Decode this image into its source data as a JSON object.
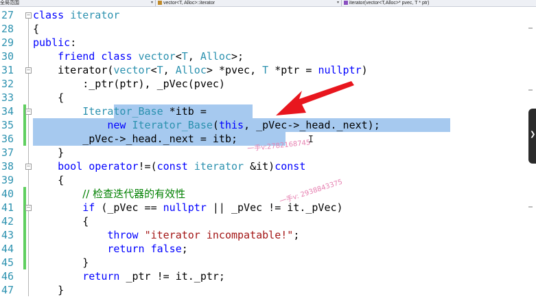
{
  "navbar": {
    "project_scope": "全局范围",
    "class_scope": "vector<T, Alloc>::iterator",
    "member_scope": "iterator(vector<T,Alloc>* pvec, T * ptr)"
  },
  "editor": {
    "lines": [
      {
        "n": "27",
        "tokens": [
          [
            "kw",
            "class "
          ],
          [
            "ty",
            "iterator"
          ]
        ]
      },
      {
        "n": "28",
        "tokens": [
          [
            "p",
            "{"
          ]
        ]
      },
      {
        "n": "29",
        "tokens": [
          [
            "kw",
            "public"
          ],
          [
            "p",
            ":"
          ]
        ]
      },
      {
        "n": "30",
        "tokens": [
          [
            "p",
            "    "
          ],
          [
            "kw",
            "friend class "
          ],
          [
            "ty",
            "vector"
          ],
          [
            "p",
            "<"
          ],
          [
            "ty",
            "T"
          ],
          [
            "p",
            ", "
          ],
          [
            "ty",
            "Alloc"
          ],
          [
            "p",
            ">;"
          ]
        ]
      },
      {
        "n": "31",
        "tokens": [
          [
            "p",
            "    iterator("
          ],
          [
            "ty",
            "vector"
          ],
          [
            "p",
            "<"
          ],
          [
            "ty",
            "T"
          ],
          [
            "p",
            ", "
          ],
          [
            "ty",
            "Alloc"
          ],
          [
            "p",
            "> *pvec, "
          ],
          [
            "ty",
            "T"
          ],
          [
            "p",
            " *ptr = "
          ],
          [
            "kw",
            "nullptr"
          ],
          [
            "p",
            ")"
          ]
        ]
      },
      {
        "n": "32",
        "tokens": [
          [
            "p",
            "        :_ptr(ptr), _pVec(pvec)"
          ]
        ]
      },
      {
        "n": "33",
        "tokens": [
          [
            "p",
            "    {"
          ]
        ]
      },
      {
        "n": "34",
        "tokens": [
          [
            "p",
            "        "
          ],
          [
            "ty",
            "Iterator_Base"
          ],
          [
            "p",
            " *itb ="
          ]
        ]
      },
      {
        "n": "35",
        "tokens": [
          [
            "p",
            "            "
          ],
          [
            "kw",
            "new "
          ],
          [
            "ty",
            "Iterator_Base"
          ],
          [
            "p",
            "("
          ],
          [
            "kw",
            "this"
          ],
          [
            "p",
            ", _pVec->_head._next);"
          ]
        ]
      },
      {
        "n": "36",
        "tokens": [
          [
            "p",
            "        _pVec->_head._next = itb;"
          ]
        ]
      },
      {
        "n": "37",
        "tokens": [
          [
            "p",
            "    }"
          ]
        ]
      },
      {
        "n": "38",
        "tokens": [
          [
            "p",
            "    "
          ],
          [
            "kw",
            "bool "
          ],
          [
            "kw",
            "operator"
          ],
          [
            "p",
            "!=("
          ],
          [
            "kw",
            "const "
          ],
          [
            "ty",
            "iterator"
          ],
          [
            "p",
            " &it)"
          ],
          [
            "kw",
            "const"
          ]
        ]
      },
      {
        "n": "39",
        "tokens": [
          [
            "p",
            "    {"
          ]
        ]
      },
      {
        "n": "40",
        "tokens": [
          [
            "p",
            "        "
          ],
          [
            "cm",
            "// 检查迭代器的有效性"
          ]
        ]
      },
      {
        "n": "41",
        "tokens": [
          [
            "p",
            "        "
          ],
          [
            "kw",
            "if"
          ],
          [
            "p",
            " (_pVec == "
          ],
          [
            "kw",
            "nullptr"
          ],
          [
            "p",
            " || _pVec != it._pVec)"
          ]
        ]
      },
      {
        "n": "42",
        "tokens": [
          [
            "p",
            "        {"
          ]
        ]
      },
      {
        "n": "43",
        "tokens": [
          [
            "p",
            "            "
          ],
          [
            "kw",
            "throw "
          ],
          [
            "st",
            "\"iterator incompatable!\""
          ],
          [
            "p",
            ";"
          ]
        ]
      },
      {
        "n": "44",
        "tokens": [
          [
            "p",
            "            "
          ],
          [
            "kw",
            "return false"
          ],
          [
            "p",
            ";"
          ]
        ]
      },
      {
        "n": "45",
        "tokens": [
          [
            "p",
            "        }"
          ]
        ]
      },
      {
        "n": "46",
        "tokens": [
          [
            "p",
            "        "
          ],
          [
            "kw",
            "return"
          ],
          [
            "p",
            " _ptr != it._ptr;"
          ]
        ]
      },
      {
        "n": "47",
        "tokens": [
          [
            "p",
            "    }"
          ]
        ]
      }
    ]
  },
  "watermarks": {
    "wm1": "一手v:2782168745",
    "wm2": "一手v: 2938843375"
  },
  "colors": {
    "keyword": "#0000ff",
    "type": "#2b91af",
    "comment": "#008000",
    "string": "#a31515",
    "selection": "#a6c9ef",
    "change_bar": "#5fcf5f",
    "arrow": "#e8161e"
  },
  "icons": {
    "fold": "collapse-box-icon",
    "arrow": "red-arrow-annotation",
    "cursor": "ibeam-cursor-icon",
    "side_tab": "chevron-right-icon"
  }
}
